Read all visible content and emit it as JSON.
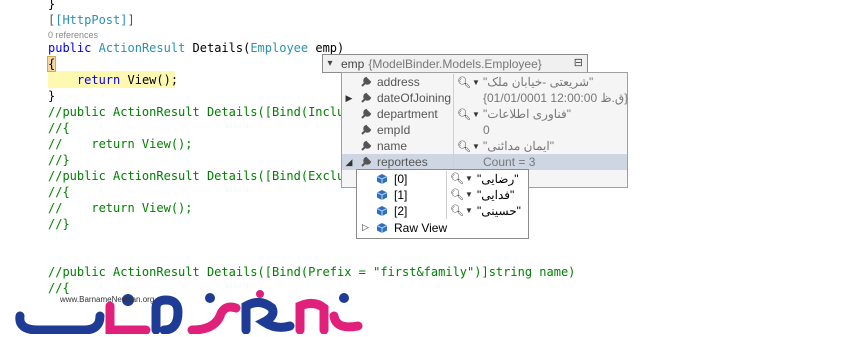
{
  "code": {
    "lines": [
      {
        "text": "}"
      },
      {
        "text": "[HttpPost]"
      },
      {
        "text": "0 references"
      },
      {
        "pre_kw": "public",
        "type1": "ActionResult",
        "mid": " Details(",
        "type2": "Employee",
        "post": " emp)"
      },
      {
        "text": "{"
      },
      {
        "indent": "    ",
        "kw": "return",
        "call": " View",
        "post": "();"
      },
      {
        "text": "}"
      },
      {
        "text": "//public ActionResult Details([Bind(Incluc"
      },
      {
        "text": "//{"
      },
      {
        "text": "//    return View();"
      },
      {
        "text": "//}"
      },
      {
        "text": "//public ActionResult Details([Bind(Exclud"
      },
      {
        "text": "//{"
      },
      {
        "text": "//    return View();"
      },
      {
        "text": "//}"
      },
      {
        "text": "//public ActionResult Details([Bind(Prefix = \"first&family\")]string name)"
      },
      {
        "text": "//{"
      }
    ]
  },
  "datatip": {
    "root_name": "emp",
    "root_value": "{ModelBinder.Models.Employee}",
    "rows": [
      {
        "name": "address",
        "value": "\"شریعتی -خیابان ملک\"",
        "expand": "",
        "has_viz": true
      },
      {
        "name": "dateOfJoining",
        "value": "{01/01/0001 12:00:00 ق.ظ}",
        "expand": "▶",
        "has_viz": false
      },
      {
        "name": "department",
        "value": "\"فناوری اطلاعات\"",
        "expand": "",
        "has_viz": true
      },
      {
        "name": "empId",
        "value": "0",
        "expand": "",
        "has_viz": false
      },
      {
        "name": "name",
        "value": "\"ایمان مدائنی\"",
        "expand": "",
        "has_viz": true
      },
      {
        "name": "reportees",
        "value": "Count = 3",
        "expand": "◢",
        "has_viz": false
      }
    ],
    "reportees": [
      {
        "index": "[0]",
        "value": "\"رضایی\""
      },
      {
        "index": "[1]",
        "value": "\"فدایی\""
      },
      {
        "index": "[2]",
        "value": "\"حسینی\""
      }
    ],
    "raw_view_label": "Raw View"
  },
  "watermark": {
    "url": "www.BarnameNevisan.org",
    "brand_text": "برنامه نویسان"
  },
  "colors": {
    "keyword": "#0000ff",
    "type": "#2b91af",
    "comment": "#008000",
    "logo_blue": "#1e3c96",
    "logo_pink": "#e0207a"
  }
}
